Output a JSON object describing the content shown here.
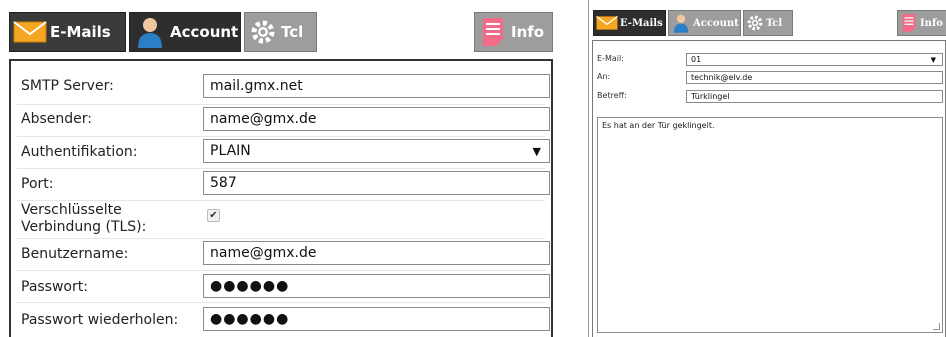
{
  "left": {
    "tabs": {
      "emails": "E-Mails",
      "account": "Account",
      "tcl": "Tcl",
      "info": "Info"
    },
    "form": {
      "smtp_label": "SMTP Server:",
      "smtp_value": "mail.gmx.net",
      "sender_label": "Absender:",
      "sender_value": "name@gmx.de",
      "auth_label": "Authentifikation:",
      "auth_value": "PLAIN",
      "port_label": "Port:",
      "port_value": "587",
      "tls_label_line1": "Verschlüsselte",
      "tls_label_line2": "Verbindung (TLS):",
      "tls_checked_glyph": "✔",
      "user_label": "Benutzername:",
      "user_value": "name@gmx.de",
      "password_label": "Passwort:",
      "password_value": "●●●●●●",
      "password_repeat_label": "Passwort wiederholen:",
      "password_repeat_value": "●●●●●●"
    }
  },
  "right": {
    "tabs": {
      "emails": "E-Mails",
      "account": "Account",
      "tcl": "Tcl",
      "info": "Info"
    },
    "form": {
      "email_label": "E-Mail:",
      "email_value": "01",
      "to_label": "An:",
      "to_value": "technik@elv.de",
      "subject_label": "Betreff:",
      "subject_value": "Türklingel",
      "body_value": "Es hat an der Tür geklingelt."
    }
  },
  "colors": {
    "tab_dark": "#3a3a3a",
    "tab_light": "#9d9d9d",
    "mail_icon": "#f5a623",
    "user_icon_blue": "#2b7fc6",
    "info_icon_pink": "#f26b87"
  }
}
